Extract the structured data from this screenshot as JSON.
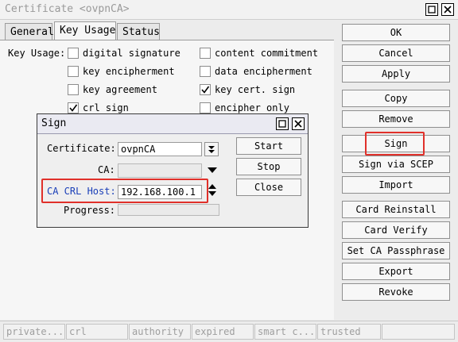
{
  "window": {
    "title": "Certificate <ovpnCA>"
  },
  "tabs": [
    {
      "label": "General"
    },
    {
      "label": "Key Usage"
    },
    {
      "label": "Status"
    }
  ],
  "key_usage": {
    "label": "Key Usage:",
    "left": [
      {
        "label": "digital signature",
        "checked": false
      },
      {
        "label": "key encipherment",
        "checked": false
      },
      {
        "label": "key agreement",
        "checked": false
      },
      {
        "label": "crl sign",
        "checked": true
      }
    ],
    "right": [
      {
        "label": "content commitment",
        "checked": false
      },
      {
        "label": "data encipherment",
        "checked": false
      },
      {
        "label": "key cert. sign",
        "checked": true
      },
      {
        "label": "encipher only",
        "checked": false
      }
    ]
  },
  "buttons": [
    {
      "label": "OK"
    },
    {
      "label": "Cancel"
    },
    {
      "label": "Apply"
    },
    {
      "label": "Copy"
    },
    {
      "label": "Remove"
    },
    {
      "label": "Sign"
    },
    {
      "label": "Sign via SCEP"
    },
    {
      "label": "Import"
    },
    {
      "label": "Card Reinstall"
    },
    {
      "label": "Card Verify"
    },
    {
      "label": "Set CA Passphrase"
    },
    {
      "label": "Export"
    },
    {
      "label": "Revoke"
    }
  ],
  "dialog": {
    "title": "Sign",
    "certificate_label": "Certificate:",
    "certificate_value": "ovpnCA",
    "ca_label": "CA:",
    "ca_value": "",
    "ca_crl_host_label": "CA CRL Host:",
    "ca_crl_host_value": "192.168.100.1",
    "progress_label": "Progress:",
    "progress_value": "",
    "start_label": "Start",
    "stop_label": "Stop",
    "close_label": "Close"
  },
  "status_bar": [
    {
      "text": "private..."
    },
    {
      "text": "crl"
    },
    {
      "text": "authority"
    },
    {
      "text": "expired"
    },
    {
      "text": "smart c..."
    },
    {
      "text": "trusted"
    },
    {
      "text": ""
    }
  ],
  "colors": {
    "highlight": "#e0302a",
    "link_label": "#1a3fb8"
  }
}
